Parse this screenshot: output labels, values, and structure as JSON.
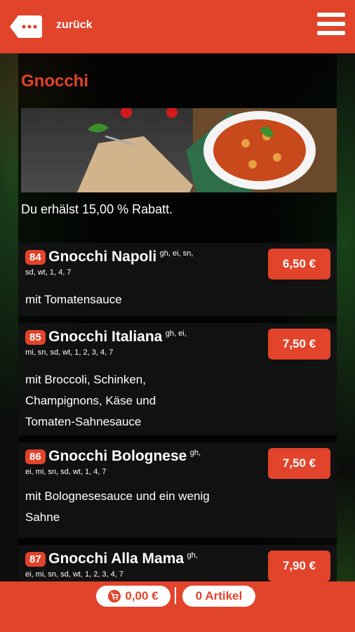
{
  "header": {
    "back_label": "zurück",
    "accent": "#e2432b"
  },
  "category": {
    "title": "Gnocchi",
    "discount_text": "Du erhälst 15,00 % Rabatt."
  },
  "items": [
    {
      "number": "84",
      "name": "Gnocchi Napoli",
      "allergens_a": "gh, ei, sn,",
      "allergens_b": "sd, wt, 1, 4, 7",
      "description": "mit Tomatensauce",
      "price": "6,50 €"
    },
    {
      "number": "85",
      "name": "Gnocchi Italiana",
      "allergens_a": "gh, ei,",
      "allergens_b": "mi, sn, sd, wt, 1, 2, 3, 4, 7",
      "description": "mit Broccoli, Schinken, Champignons, Käse und Tomaten-Sahnesauce",
      "price": "7,50 €"
    },
    {
      "number": "86",
      "name": "Gnocchi Bolognese",
      "allergens_a": "gh,",
      "allergens_b": "ei, mi, sn, sd, wt, 1, 4, 7",
      "description": "mit Bolognesesauce und ein wenig Sahne",
      "price": "7,50 €"
    },
    {
      "number": "87",
      "name": "Gnocchi Alla Mama",
      "allergens_a": "gh,",
      "allergens_b": "ei, mi, sn, sd, wt, 1, 2, 3, 4, 7",
      "description": "",
      "price": "7,90 €"
    }
  ],
  "footer": {
    "cart_total": "0,00 €",
    "article_count": "0 Artikel"
  }
}
